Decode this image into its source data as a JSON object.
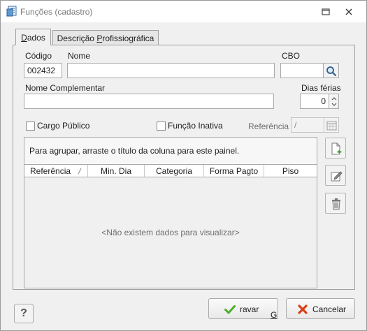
{
  "window": {
    "title": "Funções (cadastro)",
    "icon": "app-form-icon",
    "controls": [
      "restore-icon",
      "close-icon"
    ]
  },
  "tabs": [
    {
      "label": "Dados",
      "underline": "D",
      "active": true
    },
    {
      "label": "Descrição Profissiográfica",
      "underline": "P",
      "active": false
    }
  ],
  "form": {
    "codigo_label": "Código",
    "codigo_value": "002432",
    "nome_label": "Nome",
    "nome_value": "",
    "cbo_label": "CBO",
    "cbo_value": "",
    "nome_complementar_label": "Nome Complementar",
    "nome_complementar_value": "",
    "dias_ferias_label": "Dias férias",
    "dias_ferias_value": "0",
    "cargo_publico_label": "Cargo Público",
    "cargo_publico_checked": false,
    "funcao_inativa_label": "Função Inativa",
    "funcao_inativa_checked": false,
    "referencia_label": "Referência",
    "referencia_value": " /"
  },
  "grid": {
    "group_hint": "Para agrupar, arraste o título da coluna para este painel.",
    "columns": [
      "Referência",
      "Min. Dia",
      "Categoria",
      "Forma Pagto",
      "Piso"
    ],
    "rows": [],
    "empty_message": "<Não existem dados para visualizar>"
  },
  "side_buttons": [
    "add-document-icon",
    "edit-icon",
    "trash-icon"
  ],
  "footer": {
    "help_label": "?",
    "save_label": "Gravar",
    "cancel_label": "Cancelar",
    "save_color": "#4caf2a",
    "cancel_color": "#d8401a"
  }
}
